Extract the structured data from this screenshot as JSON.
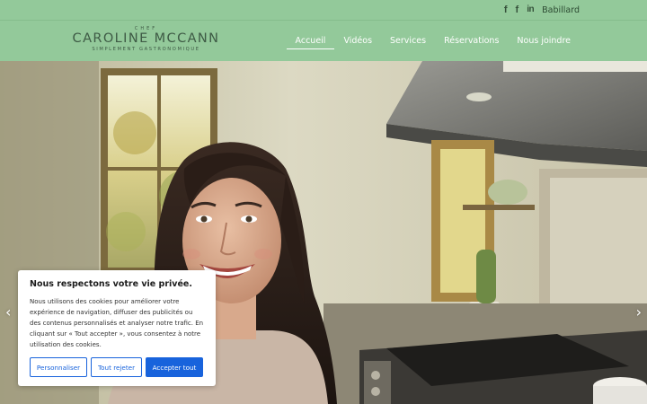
{
  "topbar": {
    "social": [
      {
        "name": "facebook-icon",
        "glyph": "f"
      },
      {
        "name": "facebook-icon-2",
        "glyph": "f"
      },
      {
        "name": "linkedin-icon",
        "glyph": "in"
      }
    ],
    "link_label": "Babillard"
  },
  "logo": {
    "top_word": "CHEF",
    "name": "CAROLINE MCCANN",
    "tagline": "SIMPLEMENT GASTRONOMIQUE"
  },
  "nav": {
    "items": [
      {
        "label": "Accueil",
        "active": true
      },
      {
        "label": "Vidéos",
        "active": false
      },
      {
        "label": "Services",
        "active": false
      },
      {
        "label": "Réservations",
        "active": false
      },
      {
        "label": "Nous joindre",
        "active": false
      }
    ]
  },
  "hero": {
    "prev_glyph": "‹",
    "next_glyph": "›"
  },
  "cookie": {
    "title": "Nous respectons votre vie privée.",
    "text": "Nous utilisons des cookies pour améliorer votre expérience de navigation, diffuser des publicités ou des contenus personnalisés et analyser notre trafic. En cliquant sur « Tout accepter », vous consentez à notre utilisation des cookies.",
    "customize_label": "Personnaliser",
    "reject_label": "Tout rejeter",
    "accept_label": "Accepter tout"
  },
  "colors": {
    "header_green": "#93c99a",
    "cookie_blue": "#1863dc"
  }
}
